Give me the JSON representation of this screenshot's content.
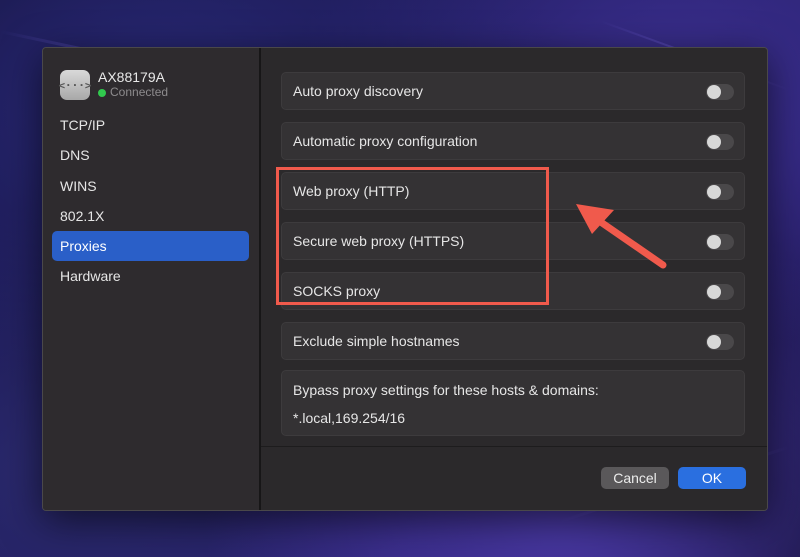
{
  "adapter": {
    "name": "AX88179A",
    "status": "Connected",
    "icon": "ethernet-icon",
    "icon_glyph": "<···>"
  },
  "sidebar": {
    "items": [
      {
        "label": "TCP/IP",
        "active": false
      },
      {
        "label": "DNS",
        "active": false
      },
      {
        "label": "WINS",
        "active": false
      },
      {
        "label": "802.1X",
        "active": false
      },
      {
        "label": "Proxies",
        "active": true
      },
      {
        "label": "Hardware",
        "active": false
      }
    ]
  },
  "proxies": {
    "rows": [
      {
        "label": "Auto proxy discovery",
        "enabled": false
      },
      {
        "label": "Automatic proxy configuration",
        "enabled": false
      },
      {
        "label": "Web proxy (HTTP)",
        "enabled": false
      },
      {
        "label": "Secure web proxy (HTTPS)",
        "enabled": false
      },
      {
        "label": "SOCKS proxy",
        "enabled": false
      },
      {
        "label": "Exclude simple hostnames",
        "enabled": false
      }
    ],
    "bypass_label": "Bypass proxy settings for these hosts & domains:",
    "bypass_value": "*.local,169.254/16"
  },
  "footer": {
    "cancel_label": "Cancel",
    "ok_label": "OK"
  },
  "colors": {
    "accent": "#2a6fe0",
    "selection": "#2a5fc8",
    "annotation": "#f05a4c",
    "status_green": "#31c94e"
  }
}
